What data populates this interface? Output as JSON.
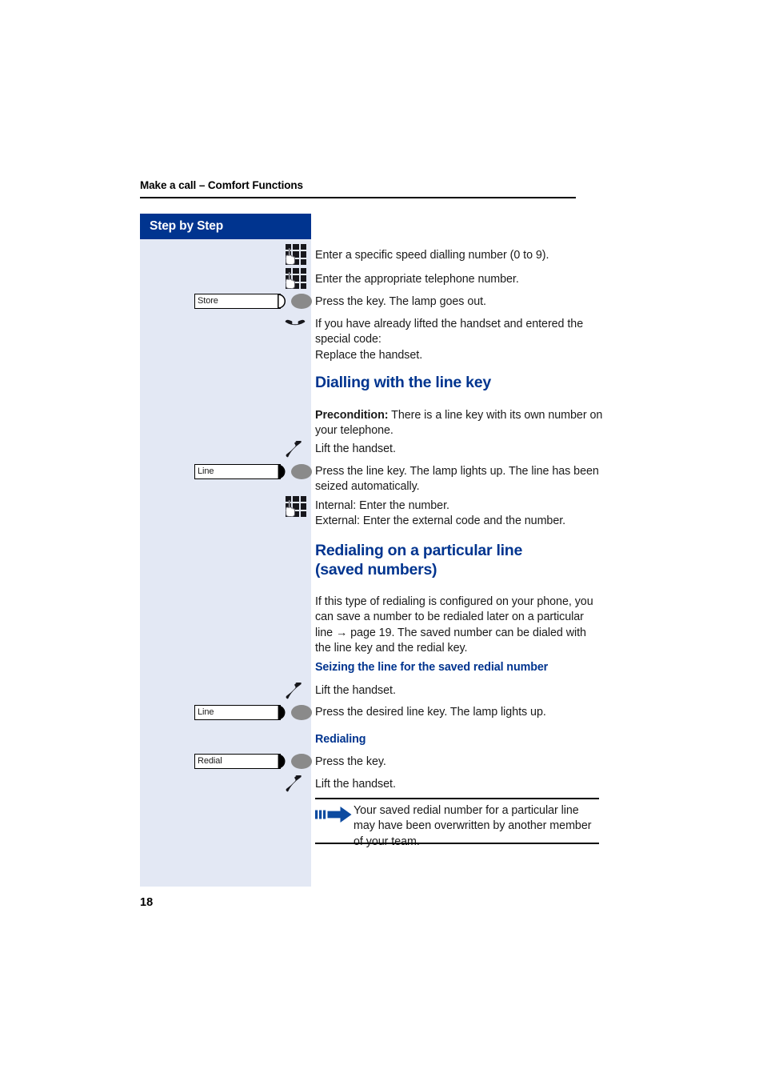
{
  "page": {
    "running_head": "Make a call – Comfort Functions",
    "folio": "18",
    "accent_blue": "#00348f",
    "sidebar_bg": "#e3e8f4",
    "lamp_gray": "#8a8a8a"
  },
  "sidebar": {
    "title": "Step by Step",
    "keys": [
      {
        "label": "Store",
        "half": "outline",
        "icon": "function-key-store"
      },
      {
        "label": "Line",
        "half": "filled",
        "icon": "function-key-line"
      },
      {
        "label": "Line2",
        "half": "filled",
        "icon": "function-key-line-2"
      },
      {
        "label": "Redial",
        "half": "filled",
        "icon": "function-key-redial"
      }
    ],
    "key_labels": {
      "store": "Store",
      "line_dial": "Line",
      "line_seize": "Line",
      "redial": "Redial"
    }
  },
  "steps": {
    "speed_dial_number": "Enter a specific speed dialling number (0 to 9).",
    "telephone_number": "Enter the appropriate telephone number.",
    "press_key_lamp_out": "Press the key. The lamp goes out.",
    "replace_handset": "If you have already lifted the handset and entered the special code:\nReplace the handset.",
    "replace_handset_l1": "If you have already lifted the handset and entered the",
    "replace_handset_l2": "special code:",
    "replace_handset_l3": "Replace the handset.",
    "lift_handset": "Lift the handset.",
    "press_line_key": "Press the line key. The lamp lights up. The line has been seized automatically.",
    "enter_number_int_ext_l1": "Internal: Enter the number.",
    "enter_number_int_ext_l2": "External: Enter the external code and the number.",
    "press_desired_line_key": "Press the desired line key. The lamp lights up.",
    "press_the_key": "Press the key."
  },
  "sections": {
    "dialling_line_key": {
      "heading": "Dialling with the line key",
      "precondition_label": "Precondition:",
      "precondition_text": " There is a line key with its own number on your telephone."
    },
    "redialing_particular_line": {
      "heading_line1": "Redialing on a particular line",
      "heading_line2": "(saved numbers)",
      "body": "If this type of redialing is configured on your phone, you can save a number to be redialed later on a particular line → page 19. The saved number can be dialed with the line key and the redial key.",
      "sub_seizing": "Seizing the line for the saved redial number",
      "sub_redialing": "Redialing"
    }
  },
  "note": {
    "text": "Your saved redial number for a particular line may have been overwritten by another member of your team."
  }
}
